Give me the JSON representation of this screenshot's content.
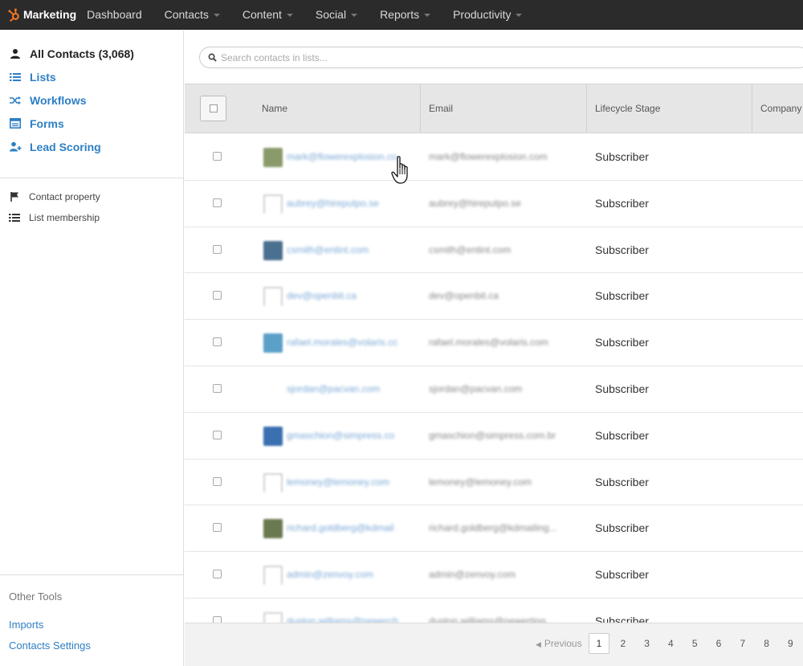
{
  "topnav": {
    "brand": "Marketing",
    "brand_color": "#f57722",
    "items": [
      {
        "label": "Dashboard",
        "has_caret": false
      },
      {
        "label": "Contacts",
        "has_caret": true
      },
      {
        "label": "Content",
        "has_caret": true
      },
      {
        "label": "Social",
        "has_caret": true
      },
      {
        "label": "Reports",
        "has_caret": true
      },
      {
        "label": "Productivity",
        "has_caret": true
      }
    ]
  },
  "sidebar": {
    "items": [
      {
        "label": "All Contacts (3,068)",
        "icon": "person-icon",
        "active": true
      },
      {
        "label": "Lists",
        "icon": "list-icon",
        "active": false
      },
      {
        "label": "Workflows",
        "icon": "shuffle-icon",
        "active": false
      },
      {
        "label": "Forms",
        "icon": "form-icon",
        "active": false
      },
      {
        "label": "Lead Scoring",
        "icon": "add-user-icon",
        "active": false
      }
    ],
    "filters": [
      {
        "label": "Contact property",
        "icon": "flag-icon"
      },
      {
        "label": "List membership",
        "icon": "list-icon"
      }
    ],
    "other_tools_label": "Other Tools",
    "tools": [
      {
        "label": "Imports"
      },
      {
        "label": "Contacts Settings"
      }
    ]
  },
  "search": {
    "placeholder": "Search contacts in lists..."
  },
  "table": {
    "columns": {
      "name": "Name",
      "email": "Email",
      "stage": "Lifecycle Stage",
      "company": "Company"
    },
    "rows": [
      {
        "name": "mark@flowerexplosion.co",
        "email": "mark@flowerexplosion.com",
        "stage": "Subscriber",
        "avatar_color": "#8a9a6a"
      },
      {
        "name": "aubrey@hireputpo.se",
        "email": "aubrey@hireputpo.se",
        "stage": "Subscriber",
        "avatar_color": "#e6e6e6"
      },
      {
        "name": "csmith@entint.com",
        "email": "csmith@entint.com",
        "stage": "Subscriber",
        "avatar_color": "#4a7090"
      },
      {
        "name": "dev@openbit.ca",
        "email": "dev@openbit.ca",
        "stage": "Subscriber",
        "avatar_color": "#dcdcdc"
      },
      {
        "name": "rafael.morales@volaris.cc",
        "email": "rafael.morales@volaris.com",
        "stage": "Subscriber",
        "avatar_color": "#5aa0c8"
      },
      {
        "name": "sjordan@pacvan.com",
        "email": "sjordan@pacvan.com",
        "stage": "Subscriber",
        "avatar_color": "#ffffff"
      },
      {
        "name": "gmaschion@simpress.co",
        "email": "gmaschion@simpress.com.br",
        "stage": "Subscriber",
        "avatar_color": "#3a6fb0"
      },
      {
        "name": "lemoney@lemoney.com",
        "email": "lemoney@lemoney.com",
        "stage": "Subscriber",
        "avatar_color": "#dcdcdc"
      },
      {
        "name": "richard.goldberg@kdmail",
        "email": "richard.goldberg@kdmailing...",
        "stage": "Subscriber",
        "avatar_color": "#6a7a50"
      },
      {
        "name": "admin@zenvoy.com",
        "email": "admin@zenvoy.com",
        "stage": "Subscriber",
        "avatar_color": "#dcdcdc"
      },
      {
        "name": "duston.williams@newerch",
        "email": "duston.williams@newerting...",
        "stage": "Subscriber",
        "avatar_color": "#e0e0e0"
      }
    ]
  },
  "pager": {
    "prev_label": "Previous",
    "pages": [
      "1",
      "2",
      "3",
      "4",
      "5",
      "6",
      "7",
      "8",
      "9"
    ],
    "current": "1"
  }
}
